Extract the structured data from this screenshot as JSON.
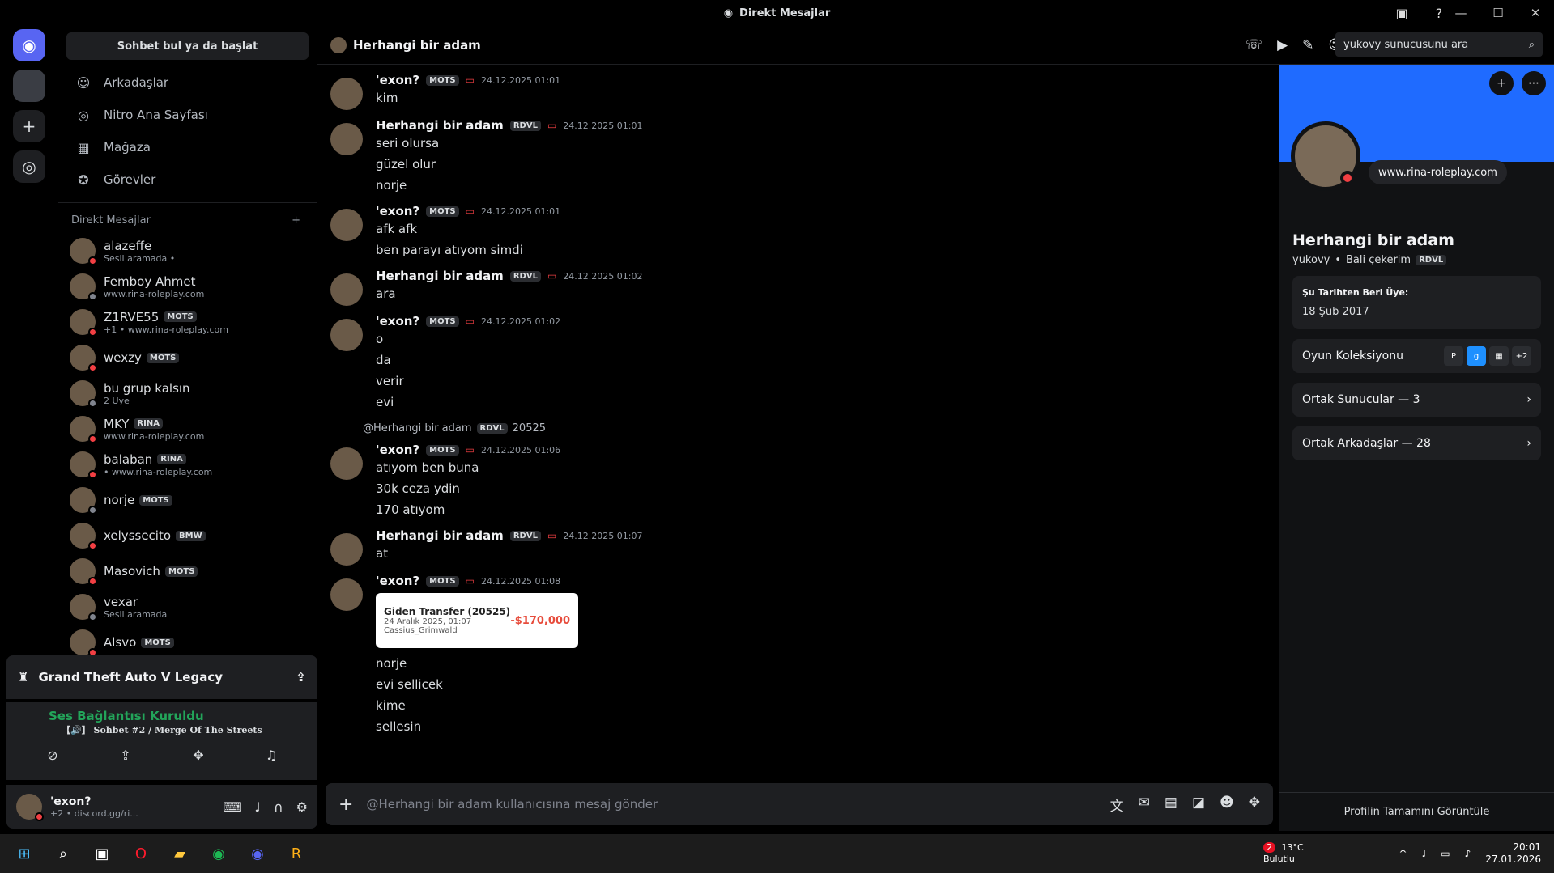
{
  "window": {
    "title": "Direkt Mesajlar"
  },
  "sidebar": {
    "search_label": "Sohbet bul ya da başlat",
    "nav": [
      {
        "label": "Arkadaşlar",
        "icon": "person-wave-icon"
      },
      {
        "label": "Nitro Ana Sayfası",
        "icon": "nitro-icon"
      },
      {
        "label": "Mağaza",
        "icon": "shop-icon"
      },
      {
        "label": "Görevler",
        "icon": "quests-icon"
      }
    ],
    "dm_header": "Direkt Mesajlar",
    "dms": [
      {
        "name": "alazeffe",
        "sub": "Sesli aramada •"
      },
      {
        "name": "Femboy Ahmet",
        "sub": "www.rina-roleplay.com"
      },
      {
        "name": "Z1RVE55",
        "tag": "MOTS",
        "sub": "+1 • www.rina-roleplay.com"
      },
      {
        "name": "wexzy",
        "tag": "MOTS",
        "sub": ""
      },
      {
        "name": "bu grup kalsın",
        "sub": "2 Üye"
      },
      {
        "name": "MKY",
        "tag": "RINA",
        "sub": "www.rina-roleplay.com"
      },
      {
        "name": "balaban",
        "tag": "RINA",
        "sub": "• www.rina-roleplay.com"
      },
      {
        "name": "norje",
        "tag": "MOTS",
        "sub": ""
      },
      {
        "name": "xelyssecito",
        "tag": "BMW",
        "sub": ""
      },
      {
        "name": "Masovich",
        "tag": "MOTS",
        "sub": ""
      },
      {
        "name": "vexar",
        "sub": "Sesli aramada"
      },
      {
        "name": "Alsvo",
        "tag": "MOTS",
        "sub": ""
      }
    ]
  },
  "gamebar": {
    "title": "Grand Theft Auto V Legacy"
  },
  "voice": {
    "status": "Ses Bağlantısı Kuruldu",
    "channel": "【🔊】 Sohbet #2 / Merge Of The Streets"
  },
  "user": {
    "name": "'exon?",
    "status": "+2 • discord.gg/ri..."
  },
  "chat": {
    "title": "Herhangi bir adam",
    "search_placeholder": "yukovy sunucusunu ara",
    "composer_placeholder": "@Herhangi bir adam kullanıcısına mesaj gönder",
    "messages": [
      {
        "author": "'exon?",
        "tag": "MOTS",
        "time": "24.12.2025 01:01",
        "lines": [
          "kim"
        ]
      },
      {
        "author": "Herhangi bir adam",
        "tag": "RDVL",
        "time": "24.12.2025 01:01",
        "lines": [
          "seri olursa",
          "güzel olur",
          "norje"
        ]
      },
      {
        "author": "'exon?",
        "tag": "MOTS",
        "time": "24.12.2025 01:01",
        "lines": [
          "afk afk",
          "ben parayı atıyom simdi"
        ]
      },
      {
        "author": "Herhangi bir adam",
        "tag": "RDVL",
        "time": "24.12.2025 01:02",
        "lines": [
          "ara"
        ]
      },
      {
        "author": "'exon?",
        "tag": "MOTS",
        "time": "24.12.2025 01:02",
        "lines": [
          "o",
          "da",
          "verir",
          "evi"
        ]
      },
      {
        "author": "'exon?",
        "tag": "MOTS",
        "time": "24.12.2025 01:06",
        "reply": "@Herhangi bir adam",
        "reply_tag": "RDVL",
        "reply_text": "20525",
        "lines": [
          "atıyom ben buna",
          "30k ceza ydin",
          "170 atıyom"
        ]
      },
      {
        "author": "Herhangi bir adam",
        "tag": "RDVL",
        "time": "24.12.2025 01:07",
        "lines": [
          "at"
        ]
      },
      {
        "author": "'exon?",
        "tag": "MOTS",
        "time": "24.12.2025 01:08",
        "transfer": {
          "title": "Giden Transfer (20525)",
          "date": "24 Aralık 2025, 01:07",
          "who": "Cassius_Grimwald",
          "amount": "-$170,000"
        },
        "lines": [
          "norje",
          "evi sellicek",
          "kime",
          "sellesin"
        ]
      }
    ]
  },
  "profile": {
    "bubble": "www.rina-roleplay.com",
    "name": "Herhangi bir adam",
    "username": "yukovy",
    "pronoun": "Bali çekerim",
    "tag": "RDVL",
    "member_since_label": "Şu Tarihten Beri Üye:",
    "member_since": "18 Şub 2017",
    "games_label": "Oyun Koleksiyonu",
    "games_more": "+2",
    "mutual_servers": "Ortak Sunucular — 3",
    "mutual_friends": "Ortak Arkadaşlar — 28",
    "footer": "Profilin Tamamını Görüntüle"
  },
  "taskbar": {
    "weather_temp": "13°C",
    "weather_desc": "Bulutlu",
    "weather_badge": "2",
    "time": "20:01",
    "date": "27.01.2026"
  }
}
